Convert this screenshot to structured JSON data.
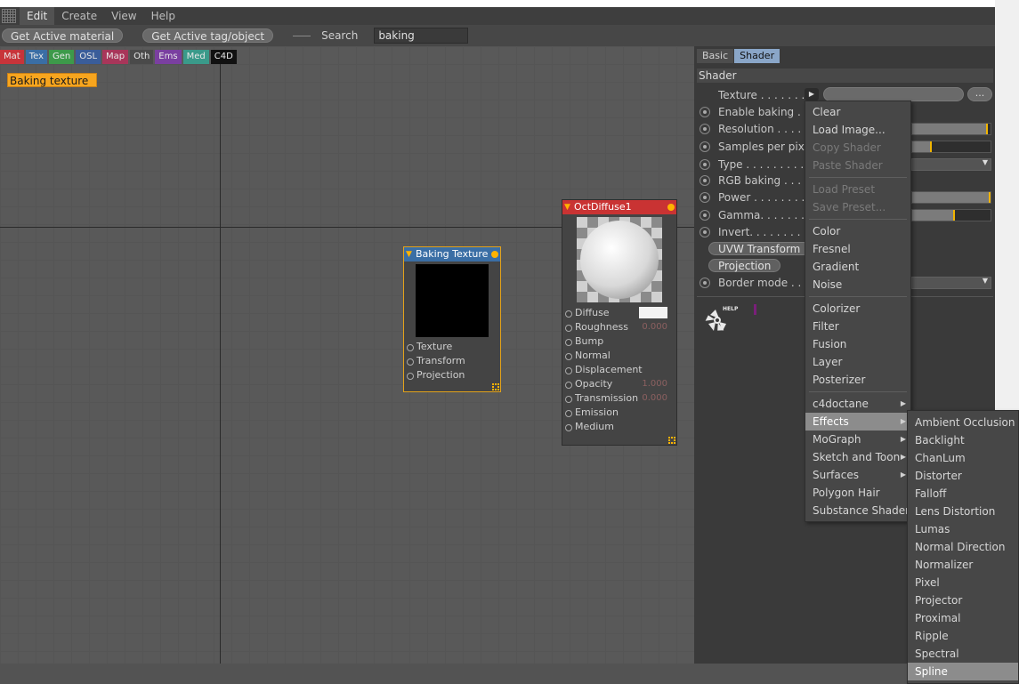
{
  "menubar": {
    "items": [
      "Edit",
      "Create",
      "View",
      "Help"
    ]
  },
  "toolbar": {
    "get_material": "Get Active material",
    "get_tag": "Get Active tag/object",
    "search_label": "Search",
    "search_value": "baking"
  },
  "categories": [
    {
      "label": "Mat",
      "color": "#c8343a"
    },
    {
      "label": "Tex",
      "color": "#3a6ea5"
    },
    {
      "label": "Gen",
      "color": "#3d9a4a"
    },
    {
      "label": "OSL",
      "color": "#3a5d9a"
    },
    {
      "label": "Map",
      "color": "#a8365a"
    },
    {
      "label": "Oth",
      "color": "#4a4a4a"
    },
    {
      "label": "Ems",
      "color": "#7a3fa0"
    },
    {
      "label": "Med",
      "color": "#3a9a8a"
    },
    {
      "label": "C4D",
      "color": "#111111"
    }
  ],
  "canvas": {
    "label_box": "Baking texture"
  },
  "node_bake": {
    "title": "Baking Texture",
    "ports": [
      "Texture",
      "Transform",
      "Projection"
    ]
  },
  "node_diffuse": {
    "title": "OctDiffuse1",
    "ports": [
      {
        "label": "Diffuse",
        "value": ""
      },
      {
        "label": "Roughness",
        "value": "0.000"
      },
      {
        "label": "Bump",
        "value": ""
      },
      {
        "label": "Normal",
        "value": ""
      },
      {
        "label": "Displacement",
        "value": ""
      },
      {
        "label": "Opacity",
        "value": "1.000"
      },
      {
        "label": "Transmission",
        "value": "0.000"
      },
      {
        "label": "Emission",
        "value": ""
      },
      {
        "label": "Medium",
        "value": ""
      }
    ]
  },
  "attr": {
    "tabs": [
      "Basic",
      "Shader"
    ],
    "section": "Shader",
    "texture_label": "Texture . . . . . . . . .",
    "texture_more": "...",
    "props": [
      "Enable baking . . .",
      "Resolution . . . . . .",
      "Samples per pixel",
      "Type . . . . . . . . . . .",
      "RGB baking . . . . .",
      "Power . . . . . . . . . .",
      "Gamma. . . . . . . . .",
      "Invert. . . . . . . . . ."
    ],
    "uvw_button": "UVW Transform",
    "projection_button": "Projection",
    "border_mode": "Border mode . . . .",
    "help_label": "HELP",
    "sliders": {
      "resolution": 0.97,
      "samples": 0.25,
      "power": 1.0,
      "gamma": 0.55
    }
  },
  "popup_main": {
    "items": [
      {
        "label": "Clear"
      },
      {
        "label": "Load Image..."
      },
      {
        "label": "Copy Shader",
        "disabled": true
      },
      {
        "label": "Paste Shader",
        "disabled": true
      },
      {
        "sep": true
      },
      {
        "label": "Load Preset",
        "disabled": true
      },
      {
        "label": "Save Preset...",
        "disabled": true
      },
      {
        "sep": true
      },
      {
        "label": "Color"
      },
      {
        "label": "Fresnel"
      },
      {
        "label": "Gradient"
      },
      {
        "label": "Noise"
      },
      {
        "sep": true
      },
      {
        "label": "Colorizer"
      },
      {
        "label": "Filter"
      },
      {
        "label": "Fusion"
      },
      {
        "label": "Layer"
      },
      {
        "label": "Posterizer"
      },
      {
        "sep": true
      },
      {
        "label": "c4doctane",
        "sub": true
      },
      {
        "label": "Effects",
        "sub": true,
        "highlight": true
      },
      {
        "label": "MoGraph",
        "sub": true
      },
      {
        "label": "Sketch and Toon",
        "sub": true
      },
      {
        "label": "Surfaces",
        "sub": true
      },
      {
        "label": "Polygon Hair"
      },
      {
        "label": "Substance Shader"
      }
    ]
  },
  "popup_effects": {
    "items": [
      {
        "label": "Ambient Occlusion"
      },
      {
        "label": "Backlight"
      },
      {
        "label": "ChanLum"
      },
      {
        "label": "Distorter"
      },
      {
        "label": "Falloff"
      },
      {
        "label": "Lens Distortion"
      },
      {
        "label": "Lumas"
      },
      {
        "label": "Normal Direction"
      },
      {
        "label": "Normalizer"
      },
      {
        "label": "Pixel"
      },
      {
        "label": "Projector"
      },
      {
        "label": "Proximal"
      },
      {
        "label": "Ripple"
      },
      {
        "label": "Spectral"
      },
      {
        "label": "Spline",
        "highlight": true
      }
    ]
  }
}
